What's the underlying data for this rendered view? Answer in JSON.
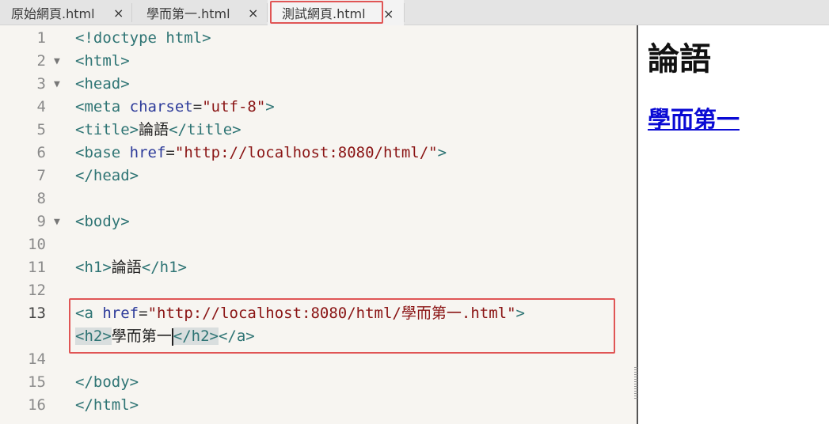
{
  "tabs": [
    {
      "label": "原始網頁.html",
      "close": "×",
      "active": false
    },
    {
      "label": "學而第一.html",
      "close": "×",
      "active": false
    },
    {
      "label": "測試網頁.html",
      "close": "×",
      "active": true
    }
  ],
  "editor": {
    "lines": [
      {
        "num": "1",
        "fold": ""
      },
      {
        "num": "2",
        "fold": "▼"
      },
      {
        "num": "3",
        "fold": "▼"
      },
      {
        "num": "4",
        "fold": ""
      },
      {
        "num": "5",
        "fold": ""
      },
      {
        "num": "6",
        "fold": ""
      },
      {
        "num": "7",
        "fold": ""
      },
      {
        "num": "8",
        "fold": ""
      },
      {
        "num": "9",
        "fold": "▼"
      },
      {
        "num": "10",
        "fold": ""
      },
      {
        "num": "11",
        "fold": ""
      },
      {
        "num": "12",
        "fold": ""
      },
      {
        "num": "13",
        "fold": ""
      },
      {
        "num": "",
        "fold": ""
      },
      {
        "num": "14",
        "fold": ""
      },
      {
        "num": "15",
        "fold": ""
      },
      {
        "num": "16",
        "fold": ""
      }
    ],
    "current_line": "13",
    "code": {
      "l1": "<!doctype html>",
      "l2": "<html>",
      "l3": "<head>",
      "l4_tag": "<meta",
      "l4_attr": "charset",
      "l4_eq": "=",
      "l4_val": "\"utf-8\"",
      "l4_end": ">",
      "l5_open": "<title>",
      "l5_text": "論語",
      "l5_close": "</title>",
      "l6_tag": "<base",
      "l6_attr": "href",
      "l6_eq": "=",
      "l6_val": "\"http://localhost:8080/html/\"",
      "l6_end": ">",
      "l7": "</head>",
      "l9": "<body>",
      "l11_open": "<h1>",
      "l11_text": "論語",
      "l11_close": "</h1>",
      "l13_tag": "<a",
      "l13_attr": "href",
      "l13_eq": "=",
      "l13_val_a": "\"http://localhost:8080/html/",
      "l13_val_cjk": "學而第一",
      "l13_val_b": ".html\"",
      "l13_end": ">",
      "l13w_open": "<h2>",
      "l13w_text": "學而第一",
      "l13w_close_h2": "</h2>",
      "l13w_close_a": "</a>",
      "l15": "</body>",
      "l16": "</html>"
    }
  },
  "preview": {
    "h1": "論語",
    "link": "學而第一"
  },
  "colors": {
    "tag": "#2e7474",
    "attr": "#2d3b9a",
    "string": "#8a1414",
    "highlight_border": "#e05555",
    "link": "#0a0ad4"
  }
}
